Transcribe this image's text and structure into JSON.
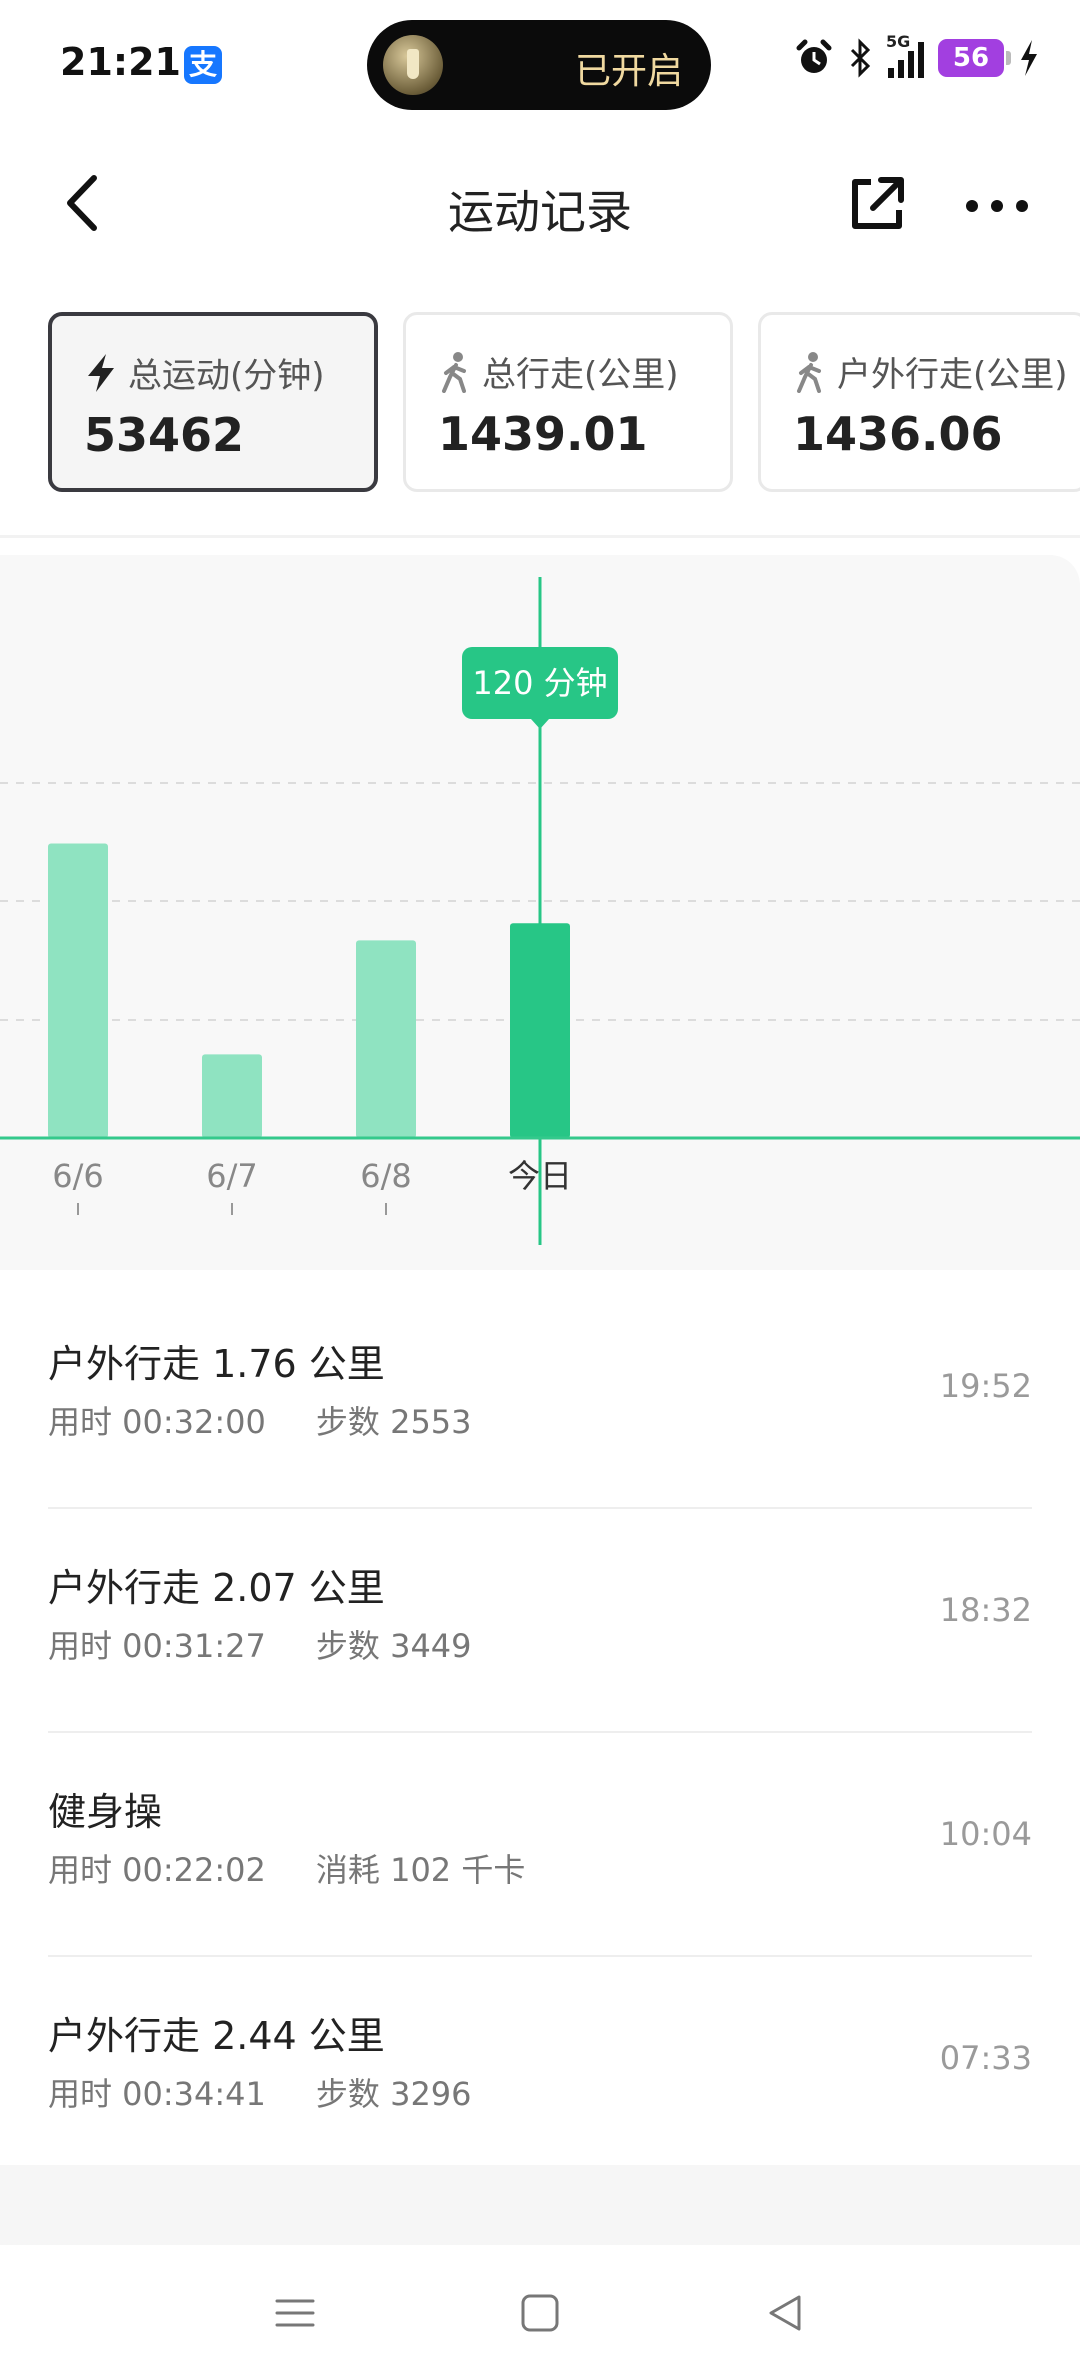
{
  "status_bar": {
    "time": "21:21",
    "alipay_glyph": "支",
    "pill_text": "已开启",
    "network_label": "5G",
    "battery": "56"
  },
  "app_bar": {
    "title": "运动记录",
    "icons": [
      "back-arrow-icon",
      "share-external-icon",
      "more-dots-icon"
    ]
  },
  "stats": [
    {
      "label": "总运动(分钟)",
      "value": "53462",
      "icon": "lightning-icon",
      "selected": true
    },
    {
      "label": "总行走(公里)",
      "value": "1439.01",
      "icon": "walking-person-icon",
      "selected": false
    },
    {
      "label": "户外行走(公里)",
      "value": "1436.06",
      "icon": "walking-person-icon",
      "selected": false
    }
  ],
  "chart_data": {
    "type": "bar",
    "categories": [
      "6/6",
      "6/7",
      "6/8",
      "今日"
    ],
    "values": [
      155,
      44,
      104,
      113
    ],
    "selected_index": 3,
    "tooltip": "120 分钟",
    "bar_color": "#8fe3c1",
    "selected_color": "#27c686",
    "grid": "dashed"
  },
  "records": [
    {
      "title": "户外行走 1.76 公里",
      "duration": "用时 00:32:00",
      "metric": "步数 2553",
      "time": "19:52"
    },
    {
      "title": "户外行走 2.07 公里",
      "duration": "用时 00:31:27",
      "metric": "步数 3449",
      "time": "18:32"
    },
    {
      "title": "健身操",
      "duration": "用时 00:22:02",
      "metric": "消耗 102 千卡",
      "time": "10:04"
    },
    {
      "title": "户外行走 2.44 公里",
      "duration": "用时 00:34:41",
      "metric": "步数 3296",
      "time": "07:33"
    }
  ],
  "nav_bar": [
    "menu-icon",
    "home-square-icon",
    "back-triangle-icon"
  ]
}
